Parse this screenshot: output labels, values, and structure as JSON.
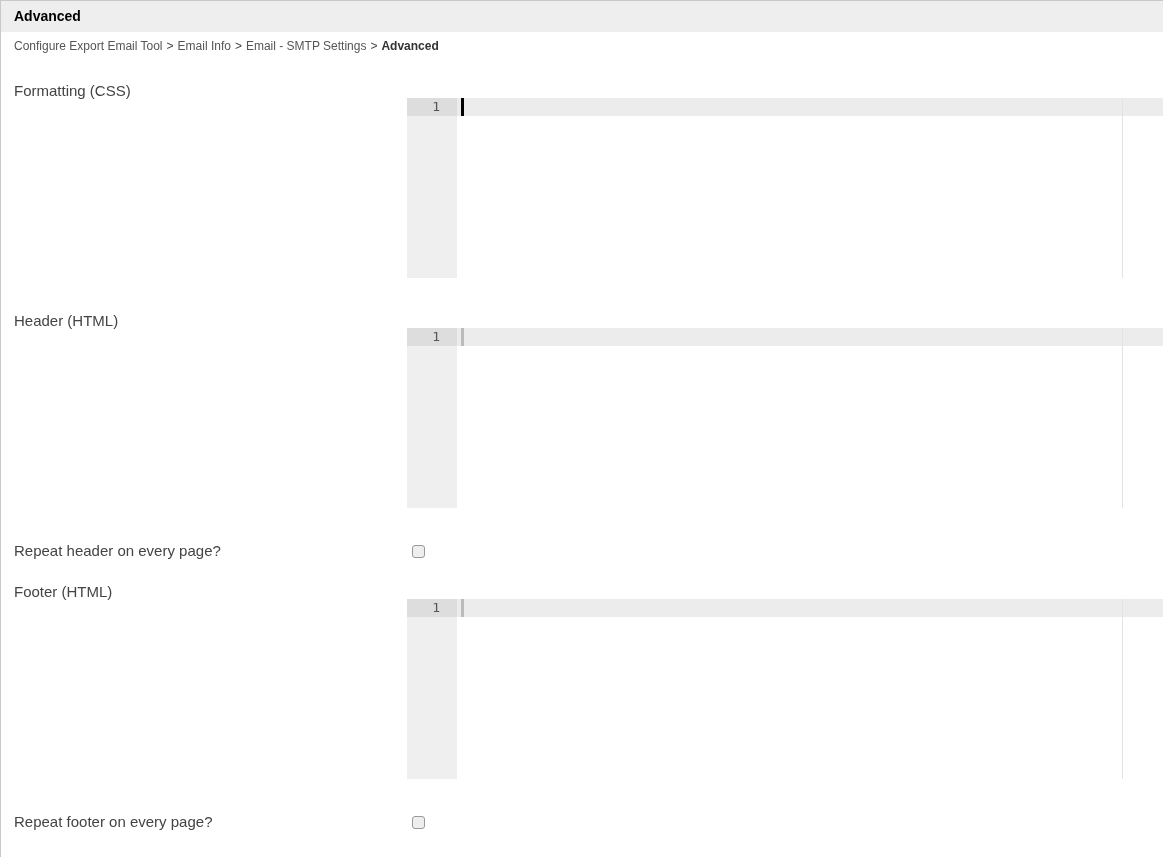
{
  "panel": {
    "title": "Advanced"
  },
  "breadcrumb_separator": ">",
  "breadcrumb": [
    {
      "label": "Configure Export Email Tool",
      "current": false
    },
    {
      "label": "Email Info",
      "current": false
    },
    {
      "label": "Email - SMTP Settings",
      "current": false
    },
    {
      "label": "Advanced",
      "current": true
    }
  ],
  "fields": [
    {
      "kind": "editor",
      "label": "Formatting (CSS)",
      "focused": true,
      "line_numbers": [
        "1"
      ]
    },
    {
      "kind": "editor",
      "label": "Header (HTML)",
      "focused": false,
      "line_numbers": [
        "1"
      ]
    },
    {
      "kind": "checkbox",
      "label": "Repeat header on every page?",
      "checked": false
    },
    {
      "kind": "editor",
      "label": "Footer (HTML)",
      "focused": false,
      "line_numbers": [
        "1"
      ]
    },
    {
      "kind": "checkbox",
      "label": "Repeat footer on every page?",
      "checked": false
    }
  ]
}
